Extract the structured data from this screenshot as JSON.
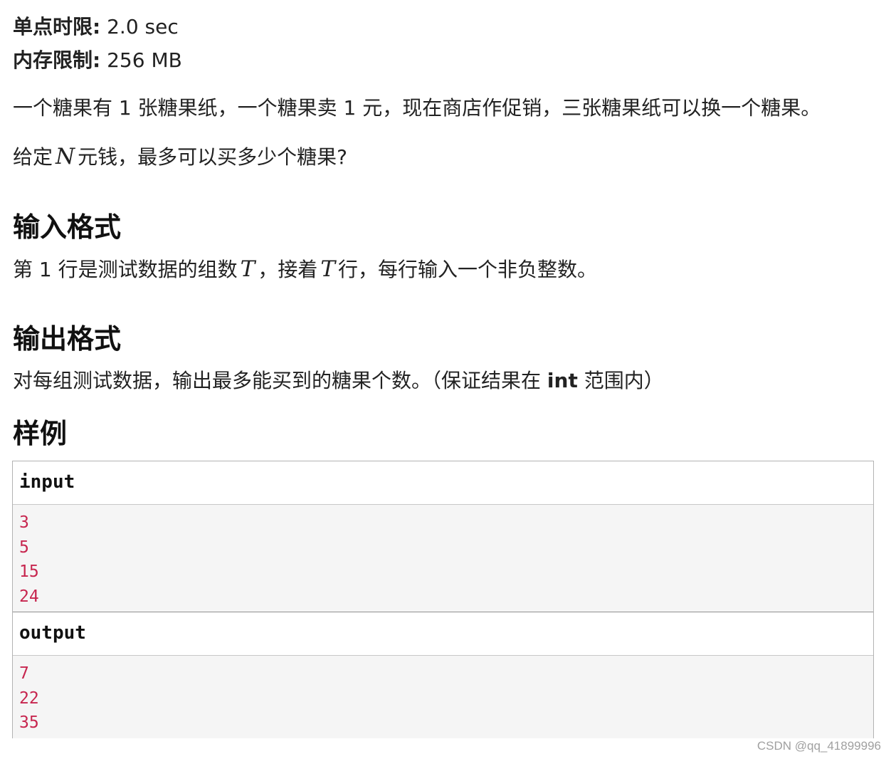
{
  "limits": {
    "time_label": "单点时限:",
    "time_value": "2.0 sec",
    "memory_label": "内存限制:",
    "memory_value": "256 MB"
  },
  "description": {
    "line1": "一个糖果有 1 张糖果纸，一个糖果卖 1 元，现在商店作促销，三张糖果纸可以换一个糖果。",
    "line2_before": "给定",
    "line2_var": "N",
    "line2_after": "元钱，最多可以买多少个糖果?"
  },
  "input_format": {
    "heading": "输入格式",
    "text_before": "第 1 行是测试数据的组数",
    "var1": "T",
    "text_middle": "，接着",
    "var2": "T",
    "text_after": "行，每行输入一个非负整数。"
  },
  "output_format": {
    "heading": "输出格式",
    "text_before": "对每组测试数据，输出最多能买到的糖果个数。（保证结果在",
    "code": "int",
    "text_after": "范围内）"
  },
  "sample": {
    "heading": "样例",
    "input_label": "input",
    "input_lines": [
      "3",
      "5",
      "15",
      "24"
    ],
    "output_label": "output",
    "output_lines": [
      "7",
      "22",
      "35"
    ]
  },
  "watermark": "CSDN @qq_41899996"
}
